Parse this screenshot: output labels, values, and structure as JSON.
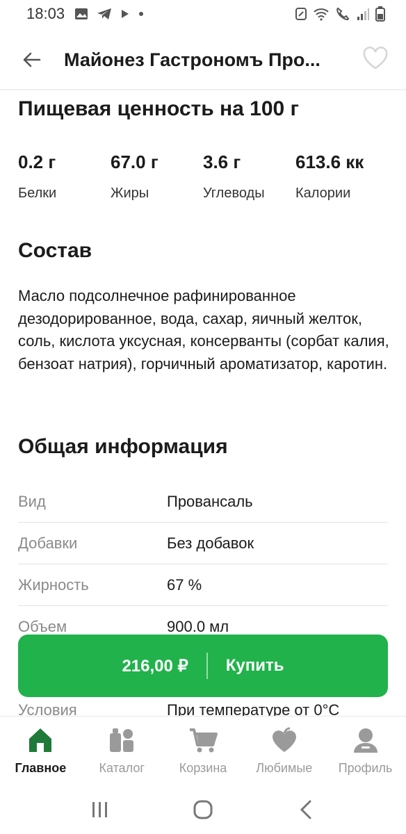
{
  "status_bar": {
    "time": "18:03"
  },
  "header": {
    "title": "Майонез Гастрономъ Про..."
  },
  "nutrition": {
    "title": "Пищевая ценность на 100 г",
    "items": [
      {
        "value": "0.2 г",
        "label": "Белки"
      },
      {
        "value": "67.0 г",
        "label": "Жиры"
      },
      {
        "value": "3.6 г",
        "label": "Углеводы"
      },
      {
        "value": "613.6 кк",
        "label": "Калории"
      }
    ]
  },
  "composition": {
    "title": "Состав",
    "text": "Масло подсолнечное рафинированное дезодорированное, вода, сахар, яичный желток, соль, кислота уксусная, консерванты (сорбат калия, бензоат натрия), горчичный ароматизатор, каротин."
  },
  "general_info": {
    "title": "Общая информация",
    "rows": [
      {
        "key": "Вид",
        "value": "Провансаль"
      },
      {
        "key": "Добавки",
        "value": "Без добавок"
      },
      {
        "key": "Жирность",
        "value": "67 %"
      },
      {
        "key": "Объем",
        "value": "900.0 мл"
      },
      {
        "key": "",
        "value": ""
      },
      {
        "key": "Условия",
        "value": "При температуре от 0°C"
      }
    ]
  },
  "buy_button": {
    "price": "216,00 ₽",
    "label": "Купить"
  },
  "bottom_nav": {
    "items": [
      {
        "label": "Главное",
        "icon": "home-icon",
        "active": true
      },
      {
        "label": "Каталог",
        "icon": "catalog-icon",
        "active": false
      },
      {
        "label": "Корзина",
        "icon": "cart-icon",
        "active": false
      },
      {
        "label": "Любимые",
        "icon": "heart-icon",
        "active": false
      },
      {
        "label": "Профиль",
        "icon": "profile-icon",
        "active": false
      }
    ]
  },
  "colors": {
    "accent": "#21b24b",
    "active_nav": "#1f7a3a",
    "inactive_nav": "#9a9a9a"
  }
}
